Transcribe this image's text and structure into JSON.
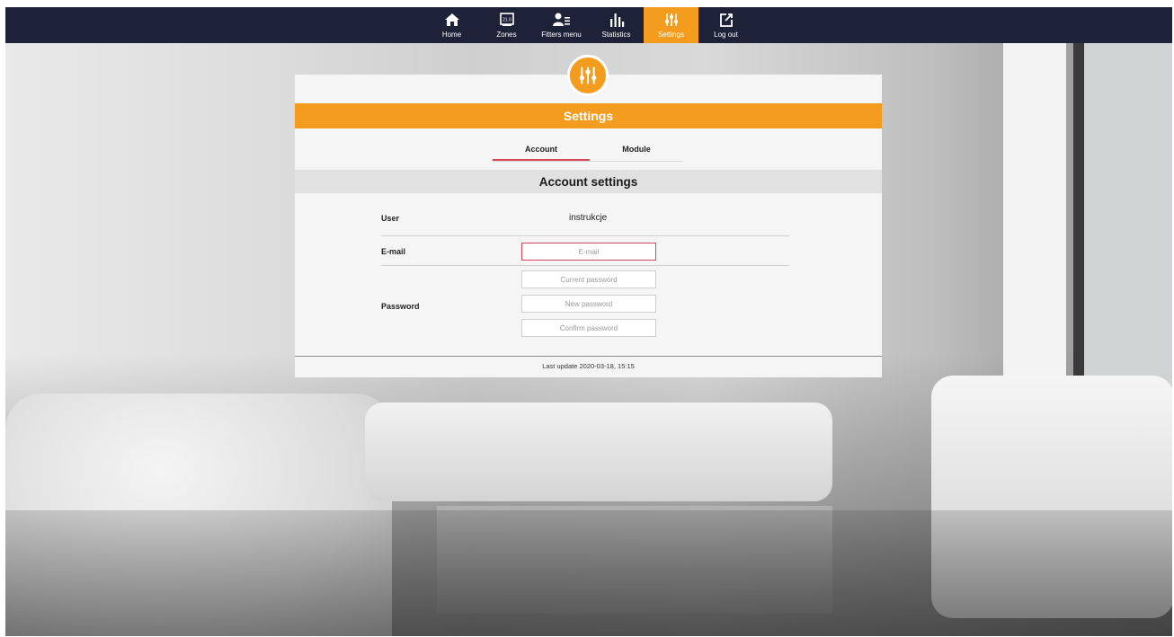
{
  "nav": {
    "items": [
      {
        "label": "Home",
        "icon": "home-icon"
      },
      {
        "label": "Zones",
        "icon": "zones-icon"
      },
      {
        "label": "Fitters menu",
        "icon": "fitters-menu-icon"
      },
      {
        "label": "Statistics",
        "icon": "statistics-icon"
      },
      {
        "label": "Settings",
        "icon": "settings-sliders-icon",
        "active": true
      },
      {
        "label": "Log out",
        "icon": "logout-icon"
      }
    ],
    "zones_icon_text": "21.0"
  },
  "panel": {
    "title": "Settings",
    "tabs": [
      {
        "label": "Account",
        "active": true
      },
      {
        "label": "Module",
        "active": false
      }
    ],
    "section_title": "Account settings",
    "user": {
      "label": "User",
      "value": "instrukcje"
    },
    "email": {
      "label": "E-mail",
      "placeholder": "E-mail",
      "value": ""
    },
    "password": {
      "label": "Password",
      "current_placeholder": "Current password",
      "new_placeholder": "New password",
      "confirm_placeholder": "Confirm password"
    },
    "footer": "Last update 2020-03-18, 15:15"
  },
  "colors": {
    "nav_bg": "#1e2239",
    "accent": "#f39c1d",
    "tab_underline": "#d9475d",
    "error_border": "#d9475d"
  }
}
